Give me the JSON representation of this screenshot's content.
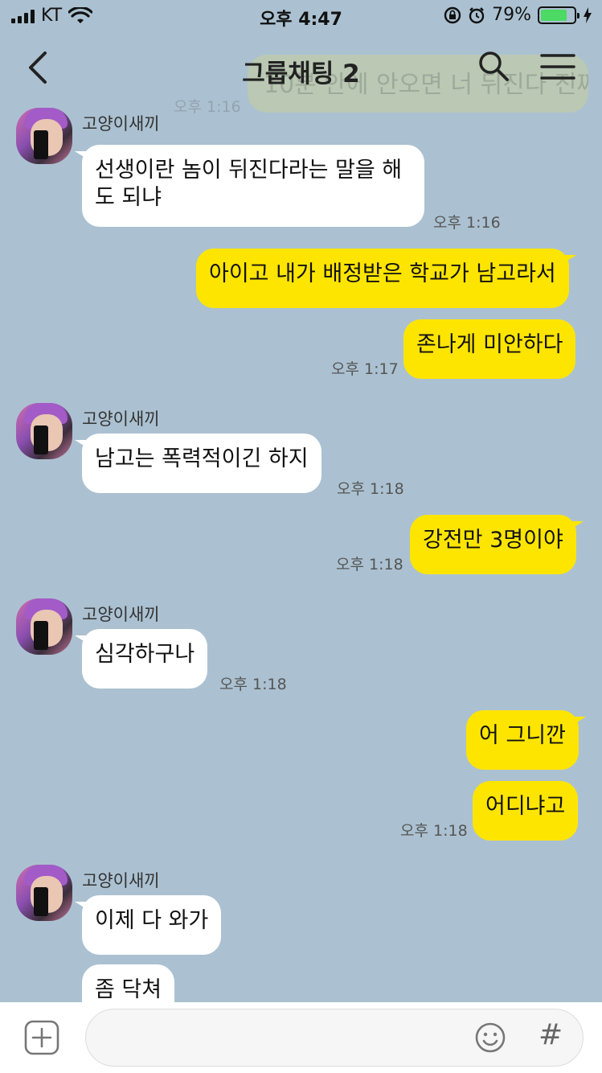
{
  "status_bar": {
    "carrier": "KT",
    "time": "오후 4:47",
    "battery_percent": "79%",
    "battery_level": 0.79
  },
  "header": {
    "title": "그룹채팅 2",
    "back_icon": "chevron-left-icon",
    "search_icon": "search-icon",
    "menu_icon": "hamburger-menu-icon",
    "ghost_message": "10분 안에 안오면 너 뒤진다 진짜",
    "ghost_time": "오후 1:16"
  },
  "messages": [
    {
      "sender": "고양이새끼",
      "type": "in",
      "lines": [
        "선생이란 놈이 뒤진다라는 말을 해",
        "도 되냐"
      ],
      "time": "오후 1:16"
    },
    {
      "type": "out",
      "text": "아이고 내가 배정받은 학교가 남고라서"
    },
    {
      "type": "out",
      "text": "존나게 미안하다",
      "time": "오후 1:17"
    },
    {
      "sender": "고양이새끼",
      "type": "in",
      "text": "남고는 폭력적이긴 하지",
      "time": "오후 1:18"
    },
    {
      "type": "out",
      "text": "강전만 3명이야",
      "time": "오후 1:18"
    },
    {
      "sender": "고양이새끼",
      "type": "in",
      "text": "심각하구나",
      "time": "오후 1:18"
    },
    {
      "type": "out",
      "text": "어 그니깐"
    },
    {
      "type": "out",
      "text": "어디냐고",
      "time": "오후 1:18"
    },
    {
      "sender": "고양이새끼",
      "type": "in",
      "text": "이제 다 와가"
    },
    {
      "type": "in",
      "text": "좀 닥쳐"
    }
  ],
  "input_bar": {
    "attach_icon": "plus-square-icon",
    "placeholder": "",
    "emoji_icon": "smile-icon",
    "hash_label": "#"
  },
  "colors": {
    "background": "#abc1d1",
    "outgoing_bubble": "#fee500",
    "incoming_bubble": "#ffffff",
    "battery": "#4cd964"
  }
}
